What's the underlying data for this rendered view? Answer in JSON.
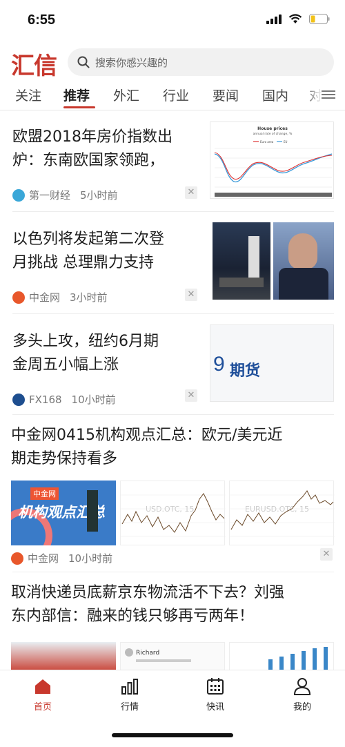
{
  "status": {
    "time": "6:55"
  },
  "header": {
    "logo": "汇信",
    "search_placeholder": "搜索你感兴趣的"
  },
  "tabs": [
    {
      "label": "关注"
    },
    {
      "label": "推荐",
      "active": true
    },
    {
      "label": "外汇"
    },
    {
      "label": "行业"
    },
    {
      "label": "要闻"
    },
    {
      "label": "国内"
    },
    {
      "label": "对"
    }
  ],
  "articles": [
    {
      "title_line1": "欧盟2018年房价指数出",
      "title_line2": "炉：东南欧国家领跑，",
      "source": "第一财经",
      "time": "5小时前",
      "thumb": {
        "chart_title": "House prices",
        "chart_subtitle": "annual rate of change, %",
        "legend": [
          "Euro area",
          "EU"
        ]
      }
    },
    {
      "title_line1": "以色列将发起第二次登",
      "title_line2": "月挑战 总理鼎力支持",
      "source": "中金网",
      "time": "3小时前"
    },
    {
      "title_line1": "多头上攻，纽约6月期",
      "title_line2": "金周五小幅上涨",
      "source": "FX168",
      "time": "10小时前",
      "thumb": {
        "text_num": "9",
        "text_cn": "期货"
      }
    },
    {
      "title_line1": "中金网0415机构观点汇总：欧元/美元近",
      "title_line2": "期走势保持看多",
      "source": "中金网",
      "time": "10小时前",
      "images": [
        {
          "brand": "中金网",
          "caption": "机构观点汇总"
        },
        {
          "watermark": "USD.OTC, 15"
        },
        {
          "watermark": "EURUSD.OTC, 15"
        }
      ]
    },
    {
      "title_line1": "取消快递员底薪京东物流活不下去？刘强",
      "title_line2": "东内部信：融来的钱只够再亏两年！",
      "chat_name": "Richard"
    }
  ],
  "bottom_nav": [
    {
      "label": "首页",
      "icon": "home-icon",
      "active": true
    },
    {
      "label": "行情",
      "icon": "chart-bars-icon"
    },
    {
      "label": "快讯",
      "icon": "calendar-icon"
    },
    {
      "label": "我的",
      "icon": "user-icon"
    }
  ],
  "colors": {
    "accent": "#c8382d",
    "text": "#1e1e1e",
    "meta": "#777777"
  }
}
